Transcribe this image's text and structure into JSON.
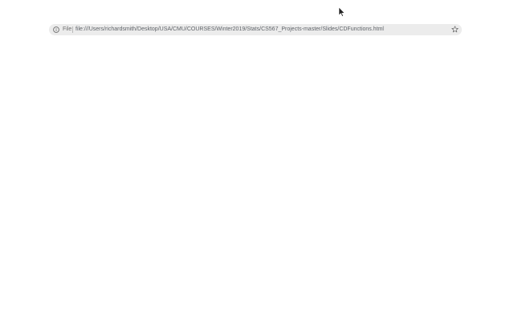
{
  "address_bar": {
    "scheme_label": "File",
    "url": "file:///Users/richardsmith/Desktop/USA/CMU/COURSES/Winter2019/Stats/CS567_Projects-master/Slides/CDFunctions.html",
    "info_icon": "info-icon",
    "bookmark_icon": "star-icon"
  },
  "toolbar": {
    "extension_icons": [
      "extension-icon-1",
      "extension-icon-2",
      "extension-icon-3",
      "extension-icon-4",
      "extension-icon-5",
      "extension-icon-6",
      "extension-icon-7",
      "extension-icon-8",
      "extension-icon-9"
    ]
  },
  "colors": {
    "address_bar_bg": "#ececec",
    "page_bg": "#ffffff",
    "url_text": "#5f6368"
  }
}
